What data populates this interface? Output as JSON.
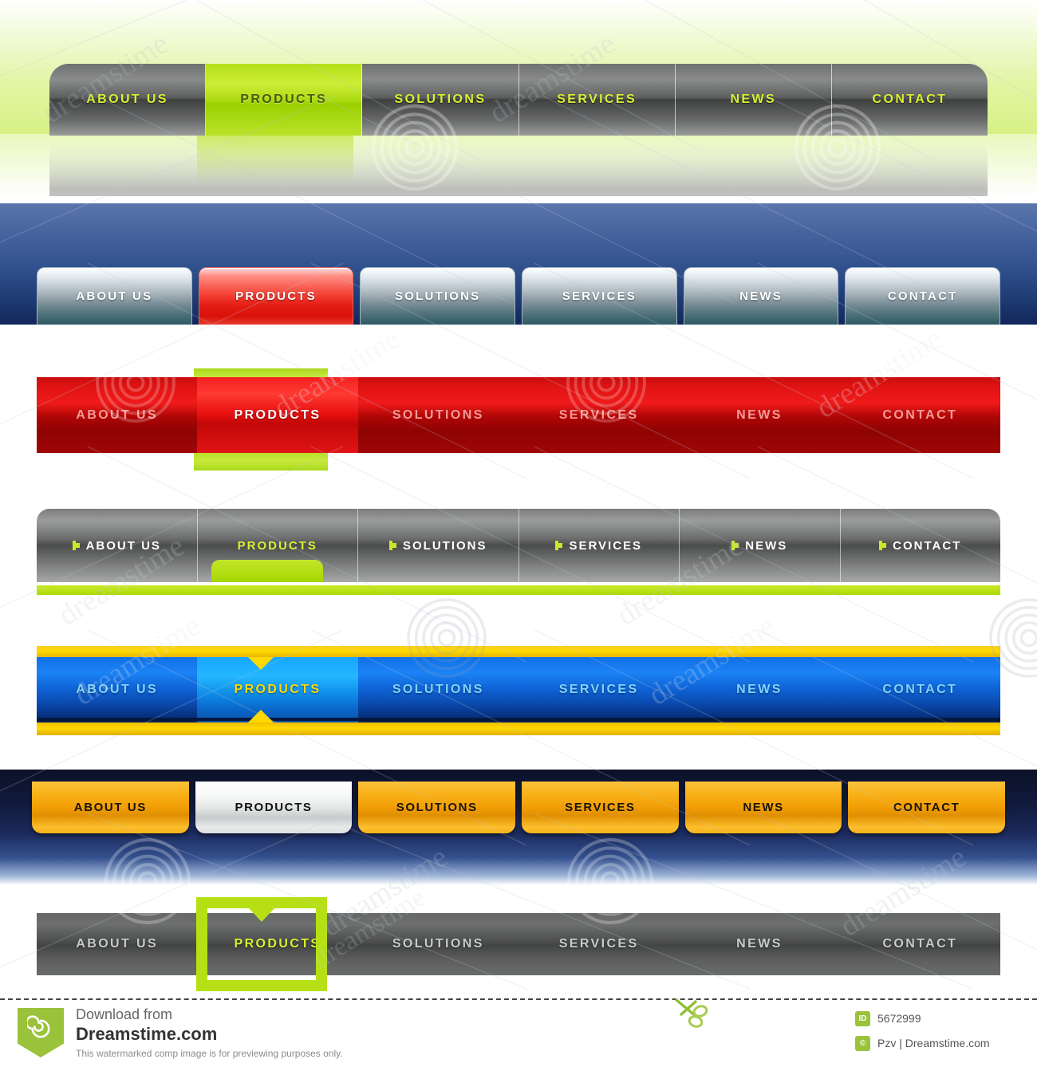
{
  "menu_labels": [
    "ABOUT US",
    "PRODUCTS",
    "SOLUTIONS",
    "SERVICES",
    "NEWS",
    "CONTACT"
  ],
  "active_label": "PRODUCTS",
  "navbars": [
    {
      "id": "green-glossy-bar",
      "style_name": "dark-glossy-with-lime-active",
      "background": "#d6f186",
      "bar_color": "#6f7070",
      "text_color": "#d8f032",
      "accent_color": "#b4e019",
      "items": [
        "ABOUT US",
        "PRODUCTS",
        "SOLUTIONS",
        "SERVICES",
        "NEWS",
        "CONTACT"
      ],
      "active_index": 1
    },
    {
      "id": "blue-panel-silver-tabs",
      "style_name": "silver-tab-buttons-on-blue",
      "background": "#2f4f8c",
      "bar_color": "#aab6bd",
      "text_color": "#ffffff",
      "accent_color": "#e51d14",
      "items": [
        "ABOUT US",
        "PRODUCTS",
        "SOLUTIONS",
        "SERVICES",
        "NEWS",
        "CONTACT"
      ],
      "active_index": 1
    },
    {
      "id": "red-bar-lime-tab",
      "style_name": "red-bar-with-lime-marker",
      "background": "#ffffff",
      "bar_color": "#c90c0c",
      "text_color": "#f39a96",
      "accent_color": "#c6ea3c",
      "items": [
        "ABOUT US",
        "PRODUCTS",
        "SOLUTIONS",
        "SERVICES",
        "NEWS",
        "CONTACT"
      ],
      "active_index": 1
    },
    {
      "id": "gray-bar-lime-bullets",
      "style_name": "gray-bar-bullets-lime-underline",
      "background": "#ffffff",
      "bar_color": "#7b7c7c",
      "text_color": "#ffffff",
      "accent_color": "#c9e829",
      "items": [
        "ABOUT US",
        "PRODUCTS",
        "SOLUTIONS",
        "SERVICES",
        "NEWS",
        "CONTACT"
      ],
      "active_index": 1,
      "bullet_icon": "arrow-bullet-icon"
    },
    {
      "id": "blue-gold-stripe-bar",
      "style_name": "blue-bar-gold-stripes",
      "background": "#ffffff",
      "bar_color": "#1170e6",
      "text_color": "#7fd4ff",
      "accent_color": "#ffd900",
      "items": [
        "ABOUT US",
        "PRODUCTS",
        "SOLUTIONS",
        "SERVICES",
        "NEWS",
        "CONTACT"
      ],
      "active_index": 1
    },
    {
      "id": "navy-orange-tabs",
      "style_name": "orange-drop-tabs-on-navy",
      "background": "#111a3c",
      "bar_color": "#f9ae15",
      "text_color": "#1a1308",
      "accent_color": "#ffffff",
      "items": [
        "ABOUT US",
        "PRODUCTS",
        "SOLUTIONS",
        "SERVICES",
        "NEWS",
        "CONTACT"
      ],
      "active_index": 1
    },
    {
      "id": "dark-gray-lime-frame",
      "style_name": "dark-gray-bar-lime-frame-active",
      "background": "#ffffff",
      "bar_color": "#5e5f5f",
      "text_color": "#c9cbcb",
      "accent_color": "#b6e015",
      "items": [
        "ABOUT US",
        "PRODUCTS",
        "SOLUTIONS",
        "SERVICES",
        "NEWS",
        "CONTACT"
      ],
      "active_index": 1
    }
  ],
  "watermark": {
    "text": "dreamstime",
    "spiral_icon": "spiral-watermark-icon"
  },
  "footer": {
    "download_from": "Download from",
    "site": "Dreamstime.com",
    "note": "This watermarked comp image is for previewing purposes only.",
    "id_chip": "ID",
    "id_value": "5672999",
    "copyright_chip": "©",
    "author": "Pzv | Dreamstime.com",
    "scissors_icon": "scissors-icon",
    "logo_icon": "dreamstime-spiral-logo"
  }
}
